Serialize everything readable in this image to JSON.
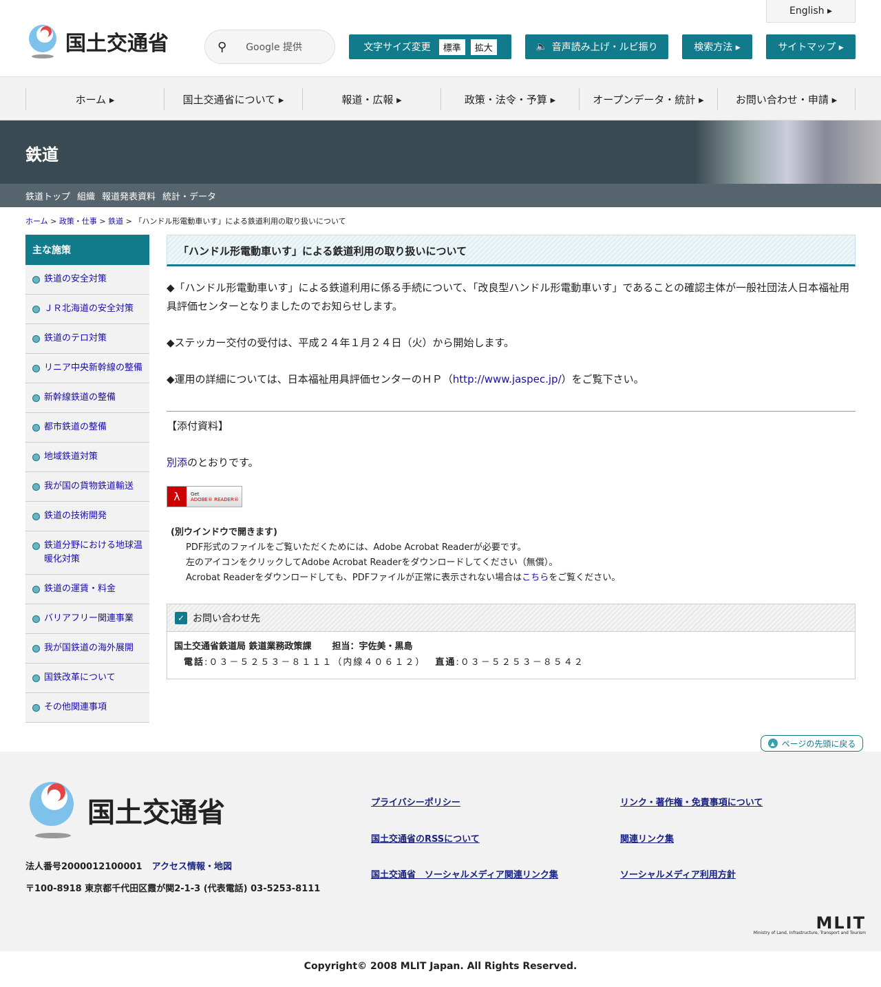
{
  "header": {
    "logo_text": "国土交通省",
    "search_placeholder": "Google 提供",
    "english": "English ▸",
    "font_size": "文字サイズ変更",
    "font_std": "標準",
    "font_big": "拡大",
    "speech": "音声読み上げ・ルビ振り",
    "search_method": "検索方法 ▸",
    "sitemap": "サイトマップ ▸"
  },
  "nav": [
    "ホーム ▸",
    "国土交通省について ▸",
    "報道・広報 ▸",
    "政策・法令・予算 ▸",
    "オープンデータ・統計 ▸",
    "お問い合わせ・申請 ▸"
  ],
  "banner": {
    "title": "鉄道"
  },
  "subnav": [
    "鉄道トップ",
    "組織",
    "報道発表資料",
    "統計・データ"
  ],
  "breadcrumb": {
    "items": [
      "ホーム",
      "政策・仕事",
      "鉄道"
    ],
    "current": "「ハンドル形電動車いす」による鉄道利用の取り扱いについて"
  },
  "sidebar": {
    "heading": "主な施策",
    "items": [
      "鉄道の安全対策",
      "ＪＲ北海道の安全対策",
      "鉄道のテロ対策",
      "リニア中央新幹線の整備",
      "新幹線鉄道の整備",
      "都市鉄道の整備",
      "地域鉄道対策",
      "我が国の貨物鉄道輸送",
      "鉄道の技術開発",
      "鉄道分野における地球温暖化対策",
      "鉄道の運賃・料金",
      "バリアフリー関連事業",
      "我が国鉄道の海外展開",
      "国鉄改革について",
      "その他関連事項"
    ]
  },
  "main": {
    "title": "「ハンドル形電動車いす」による鉄道利用の取り扱いについて",
    "p1": "◆「ハンドル形電動車いす」による鉄道利用に係る手続について、「改良型ハンドル形電動車いす」であることの確認主体が一般社団法人日本福祉用具評価センターとなりましたのでお知らせします。",
    "p2": "◆ステッカー交付の受付は、平成２４年１月２４日（火）から開始します。",
    "p3a": "◆運用の詳細については、日本福祉用具評価センターのＨＰ（",
    "p3link": "http://www.jaspec.jp/",
    "p3b": "）をご覧下さい。",
    "attach_heading": "【添付資料】",
    "attach_link": "別添",
    "attach_rest": "のとおりです。",
    "adobe_get": "Get",
    "adobe_reader": "ADOBE® READER®",
    "pdf_note_title": "(別ウインドウで開きます)",
    "pdf_note1": "PDF形式のファイルをご覧いただくためには、Adobe Acrobat Readerが必要です。",
    "pdf_note2": "左のアイコンをクリックしてAdobe Acrobat Readerをダウンロードしてください（無償）。",
    "pdf_note3a": "Acrobat Readerをダウンロードしても、PDFファイルが正常に表示されない場合は",
    "pdf_note3link": "こちら",
    "pdf_note3b": "をご覧ください。",
    "contact": {
      "heading": "お問い合わせ先",
      "dept": "国土交通省鉄道局 鉄道業務政策課",
      "person": "担当：宇佐美・黒島",
      "tel_label": "電話",
      "tel": ":０３－５２５３－８１１１（内線４０６１２）",
      "direct_label": "直通",
      "direct": ":０３－５２５３－８５４２"
    }
  },
  "back_to_top": "ページの先頭に戻る",
  "footer": {
    "logo_text": "国土交通省",
    "corp_no": "法人番号2000012100001",
    "access": "アクセス情報・地図",
    "address": "〒100-8918 東京都千代田区霞が関2-1-3 (代表電話) 03-5253-8111",
    "links": [
      "プライバシーポリシー",
      "リンク・著作権・免責事項について",
      "国土交通省のRSSについて",
      "関連リンク集",
      "国土交通省　ソーシャルメディア関連リンク集",
      "ソーシャルメディア利用方針"
    ],
    "mlit": "MLIT",
    "mlit_sub": "Ministry of Land, Infrastructure, Transport and Tourism",
    "copyright": "Copyright© 2008 MLIT Japan. All Rights Reserved."
  }
}
